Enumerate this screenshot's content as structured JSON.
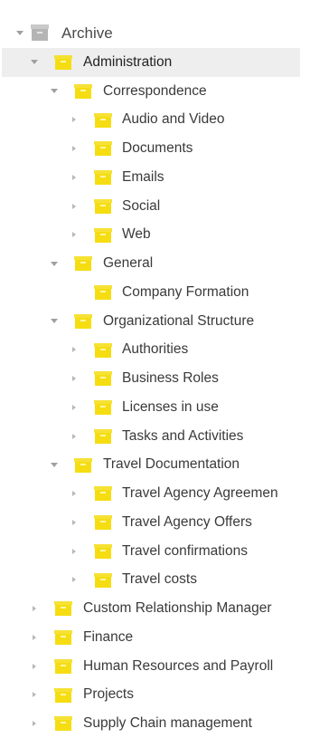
{
  "tree": {
    "root": {
      "label": "Archive",
      "icon": "archive-box-icon",
      "color": "#bdbdbd"
    },
    "accent_color": "#f5dd12",
    "items": [
      {
        "label": "Administration",
        "level": 1,
        "expanded": true,
        "selected": true
      },
      {
        "label": "Correspondence",
        "level": 2,
        "expanded": true
      },
      {
        "label": "Audio and Video",
        "level": 3,
        "expanded": false
      },
      {
        "label": "Documents",
        "level": 3,
        "expanded": false
      },
      {
        "label": "Emails",
        "level": 3,
        "expanded": false
      },
      {
        "label": "Social",
        "level": 3,
        "expanded": false
      },
      {
        "label": "Web",
        "level": 3,
        "expanded": false
      },
      {
        "label": "General",
        "level": 2,
        "expanded": true
      },
      {
        "label": "Company Formation",
        "level": 3,
        "expanded": null
      },
      {
        "label": "Organizational Structure",
        "level": 2,
        "expanded": true
      },
      {
        "label": "Authorities",
        "level": 3,
        "expanded": false
      },
      {
        "label": "Business Roles",
        "level": 3,
        "expanded": false
      },
      {
        "label": "Licenses in use",
        "level": 3,
        "expanded": false
      },
      {
        "label": "Tasks and Activities",
        "level": 3,
        "expanded": false
      },
      {
        "label": "Travel Documentation",
        "level": 2,
        "expanded": true
      },
      {
        "label": "Travel Agency Agreemen",
        "level": 3,
        "expanded": false
      },
      {
        "label": "Travel Agency Offers",
        "level": 3,
        "expanded": false
      },
      {
        "label": "Travel confirmations",
        "level": 3,
        "expanded": false
      },
      {
        "label": "Travel costs",
        "level": 3,
        "expanded": false
      },
      {
        "label": "Custom Relationship Manager",
        "level": 1,
        "expanded": false
      },
      {
        "label": "Finance",
        "level": 1,
        "expanded": false
      },
      {
        "label": "Human Resources and Payroll",
        "level": 1,
        "expanded": false
      },
      {
        "label": "Projects",
        "level": 1,
        "expanded": false
      },
      {
        "label": "Supply Chain management",
        "level": 1,
        "expanded": false
      }
    ]
  }
}
